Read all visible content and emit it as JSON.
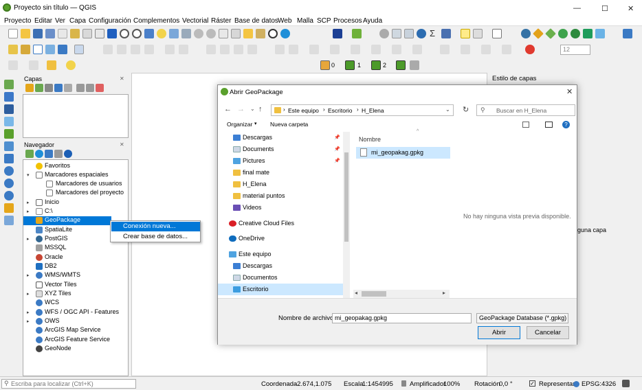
{
  "window": {
    "title": "Proyecto sin título — QGIS",
    "minimize": "—",
    "maximize": "☐",
    "close": "✕"
  },
  "menu": [
    "Proyecto",
    "Editar",
    "Ver",
    "Capa",
    "Configuración",
    "Complementos",
    "Vectorial",
    "Ráster",
    "Base de datos",
    "Web",
    "Malla",
    "SCP",
    "Procesos",
    "Ayuda"
  ],
  "toolbar": {
    "scale_value": "12",
    "snap_values": [
      "0",
      "1",
      "2"
    ]
  },
  "capas_panel": {
    "title": "Capas"
  },
  "navegador": {
    "title": "Navegador",
    "items": [
      {
        "label": "Favoritos",
        "icon": "star-icon",
        "color": "#f2c200"
      },
      {
        "label": "Marcadores espaciales",
        "icon": "bookmark-icon",
        "color": "#777777"
      },
      {
        "label": "Marcadores de usuarios",
        "icon": "folder-icon",
        "color": "#ffffff"
      },
      {
        "label": "Marcadores del proyecto",
        "icon": "folder-icon",
        "color": "#ffffff"
      },
      {
        "label": "Inicio",
        "icon": "home-icon",
        "color": "#666666"
      },
      {
        "label": "C:\\",
        "icon": "drive-icon",
        "color": "#888888"
      },
      {
        "label": "GeoPackage",
        "icon": "geopackage-icon",
        "color": "#e5a61a"
      },
      {
        "label": "SpatiaLite",
        "icon": "spatialite-icon",
        "color": "#4c86c6"
      },
      {
        "label": "PostGIS",
        "icon": "postgis-icon",
        "color": "#336791"
      },
      {
        "label": "MSSQL",
        "icon": "mssql-icon",
        "color": "#a0a0a0"
      },
      {
        "label": "Oracle",
        "icon": "oracle-icon",
        "color": "#c74634"
      },
      {
        "label": "DB2",
        "icon": "db2-icon",
        "color": "#1f70c1"
      },
      {
        "label": "WMS/WMTS",
        "icon": "globe-icon",
        "color": "#3b7ac4"
      },
      {
        "label": "Vector Tiles",
        "icon": "vector-tiles-icon",
        "color": "#555555"
      },
      {
        "label": "XYZ Tiles",
        "icon": "xyz-tiles-icon",
        "color": "#888888"
      },
      {
        "label": "WCS",
        "icon": "globe-icon",
        "color": "#3b7ac4"
      },
      {
        "label": "WFS / OGC API - Features",
        "icon": "globe-icon",
        "color": "#3b7ac4"
      },
      {
        "label": "OWS",
        "icon": "globe-icon",
        "color": "#3b7ac4"
      },
      {
        "label": "ArcGIS Map Service",
        "icon": "arcgis-icon",
        "color": "#3b7ac4"
      },
      {
        "label": "ArcGIS Feature Service",
        "icon": "arcgis-icon",
        "color": "#3b7ac4"
      },
      {
        "label": "GeoNode",
        "icon": "geonode-icon",
        "color": "#444444"
      }
    ]
  },
  "context_menu": {
    "items": [
      "Conexión nueva...",
      "Crear base de datos..."
    ]
  },
  "style_dock": {
    "title": "Estilo de capas",
    "partial_text": "guna capa"
  },
  "dialog": {
    "title": "Abrir GeoPackage",
    "breadcrumb": [
      "Este equipo",
      "Escritorio",
      "H_Elena"
    ],
    "search_placeholder": "Buscar en H_Elena",
    "organize": "Organizar",
    "new_folder": "Nueva carpeta",
    "left_pane": [
      "Descargas",
      "Documents",
      "Pictures",
      "final mate",
      "H_Elena",
      "material puntos",
      "Videos",
      "Creative Cloud Files",
      "OneDrive",
      "Este equipo",
      "Descargas",
      "Documentos",
      "Escritorio"
    ],
    "column_header": "Nombre",
    "files": [
      "mi_geopakag.gpkg"
    ],
    "preview_text": "No hay ninguna vista previa disponible.",
    "filename_label": "Nombre de archivo:",
    "filename_value": "mi_geopakag.gpkg",
    "filter_value": "GeoPackage Database (*.gpkg)",
    "open_button": "Abrir",
    "cancel_button": "Cancelar"
  },
  "statusbar": {
    "locate_placeholder": "Escriba para localizar (Ctrl+K)",
    "coord_label": "Coordenada",
    "coord_value": "-2.674,1.075",
    "scale_label": "Escala",
    "scale_value": "1:1454995",
    "magnifier_label": "Amplificador",
    "magnifier_value": "100%",
    "rotation_label": "Rotación",
    "rotation_value": "0,0 °",
    "render_label": "Representar",
    "crs": "EPSG:4326"
  },
  "colors": {
    "selection": "#0078d7",
    "accent": "#0067c0"
  }
}
